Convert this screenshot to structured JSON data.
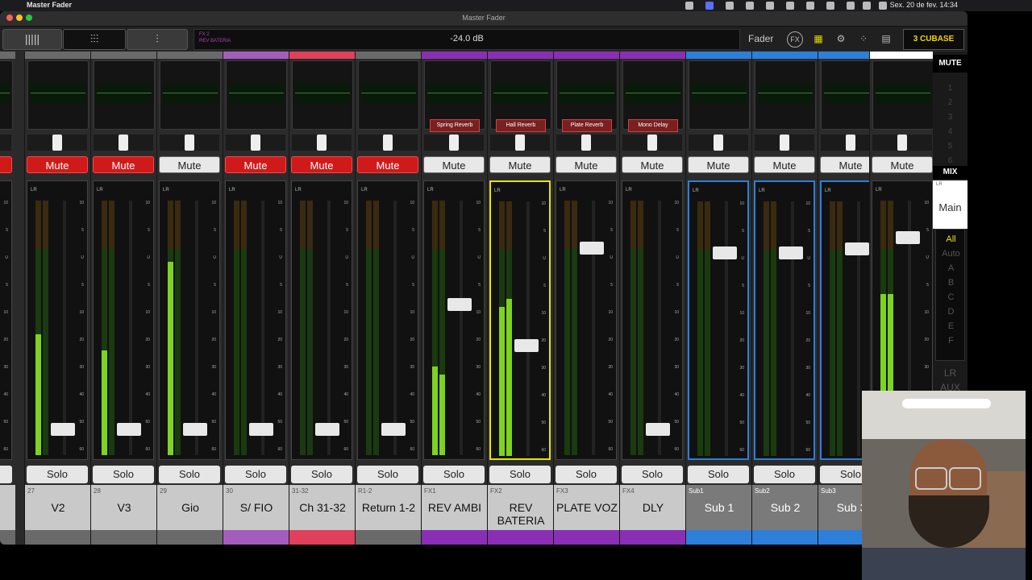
{
  "menubar": {
    "app_name": "Master Fader",
    "clock": "Sex. 20 de fev.  14:34"
  },
  "window": {
    "title": "Master Fader"
  },
  "toolbar": {
    "info_line1": "FX 2",
    "info_line2": "REV BATERIA",
    "level": "-24.0 dB",
    "mode_label": "Fader",
    "fx_label": "FX",
    "scene_number": "3",
    "scene_name": "CUBASE"
  },
  "strip_labels": {
    "solo": "Solo",
    "lr": "LR"
  },
  "scale_marks": [
    "10",
    "5",
    "U",
    "5",
    "10",
    "20",
    "30",
    "40",
    "50",
    "60"
  ],
  "strips": [
    {
      "num": "",
      "name": "",
      "mute": "Mute",
      "mute_on": true,
      "color": "#6a6a6a"
    },
    {
      "num": "27",
      "name": "V2",
      "mute": "Mute",
      "mute_on": true,
      "color": "#6a6a6a"
    },
    {
      "num": "28",
      "name": "V3",
      "mute": "Mute",
      "mute_on": true,
      "color": "#6a6a6a"
    },
    {
      "num": "29",
      "name": "Gio",
      "mute": "Mute",
      "mute_on": false,
      "color": "#6a6a6a"
    },
    {
      "num": "30",
      "name": "S/ FIO",
      "mute": "Mute",
      "mute_on": true,
      "color": "#a45dbd"
    },
    {
      "num": "31-32",
      "name": "Ch 31-32",
      "mute": "Mute",
      "mute_on": true,
      "color": "#e0405a"
    },
    {
      "num": "R1-2",
      "name": "Return 1-2",
      "mute": "Mute",
      "mute_on": true,
      "color": "#6a6a6a"
    },
    {
      "num": "FX1",
      "name": "REV AMBI",
      "mute": "Mute",
      "mute_on": false,
      "color": "#8a2fb5",
      "plugin": "Spring Reverb"
    },
    {
      "num": "FX2",
      "name": "REV BATERIA",
      "mute": "Mute",
      "mute_on": false,
      "color": "#8a2fb5",
      "plugin": "Hall Reverb"
    },
    {
      "num": "FX3",
      "name": "PLATE VOZ",
      "mute": "Mute",
      "mute_on": false,
      "color": "#8a2fb5",
      "plugin": "Plate Reverb"
    },
    {
      "num": "FX4",
      "name": "DLY",
      "mute": "Mute",
      "mute_on": false,
      "color": "#8a2fb5",
      "plugin": "Mono Delay"
    },
    {
      "num": "Sub1",
      "name": "Sub 1",
      "mute": "Mute",
      "mute_on": false,
      "color": "#2d7fd9"
    },
    {
      "num": "Sub2",
      "name": "Sub 2",
      "mute": "Mute",
      "mute_on": false,
      "color": "#2d7fd9"
    },
    {
      "num": "Sub3",
      "name": "Sub 3",
      "mute": "Mute",
      "mute_on": false,
      "color": "#2d7fd9"
    },
    {
      "num": "",
      "name": "",
      "mute": "Mute",
      "mute_on": false,
      "color": "#ffffff"
    }
  ],
  "right_panel": {
    "mute_label": "MUTE",
    "numbers": [
      "1",
      "2",
      "3",
      "4",
      "5",
      "6"
    ],
    "mix_label": "MIX",
    "main_lr": "LR",
    "main_label": "Main",
    "filters": [
      "All",
      "Auto",
      "A",
      "B",
      "C",
      "D",
      "E",
      "F"
    ],
    "bottom": [
      "LR",
      "AUX"
    ]
  }
}
